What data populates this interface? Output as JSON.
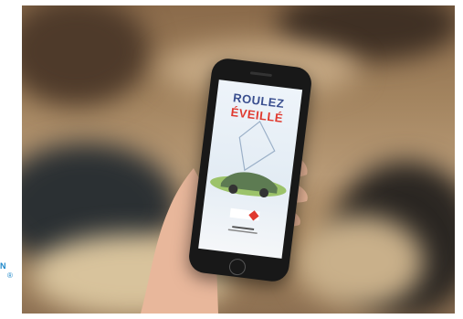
{
  "screen": {
    "title_line1": "ROULEZ",
    "title_line2": "ÉVEILLÉ"
  },
  "corner_brand": {
    "text": "N",
    "mark": "®"
  },
  "colors": {
    "title_blue": "#3a4f8f",
    "title_red": "#e03a2f",
    "brand_blue": "#1b86c8"
  }
}
